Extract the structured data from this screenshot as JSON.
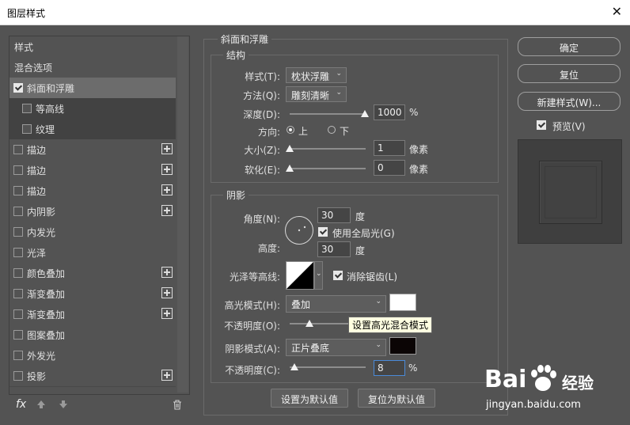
{
  "window": {
    "title": "图层样式",
    "close_glyph": "✕"
  },
  "left_list": {
    "items": [
      {
        "label": "样式",
        "checkbox": false,
        "checked": false,
        "plus": false,
        "state": "normal"
      },
      {
        "label": "混合选项",
        "checkbox": false,
        "checked": false,
        "plus": false,
        "state": "normal"
      },
      {
        "label": "斜面和浮雕",
        "checkbox": true,
        "checked": true,
        "plus": false,
        "state": "selected"
      },
      {
        "label": "等高线",
        "checkbox": true,
        "checked": false,
        "plus": false,
        "state": "sub"
      },
      {
        "label": "纹理",
        "checkbox": true,
        "checked": false,
        "plus": false,
        "state": "sub"
      },
      {
        "label": "描边",
        "checkbox": true,
        "checked": false,
        "plus": true,
        "state": "normal"
      },
      {
        "label": "描边",
        "checkbox": true,
        "checked": false,
        "plus": true,
        "state": "normal"
      },
      {
        "label": "描边",
        "checkbox": true,
        "checked": false,
        "plus": true,
        "state": "normal"
      },
      {
        "label": "内阴影",
        "checkbox": true,
        "checked": false,
        "plus": true,
        "state": "normal"
      },
      {
        "label": "内发光",
        "checkbox": true,
        "checked": false,
        "plus": false,
        "state": "normal"
      },
      {
        "label": "光泽",
        "checkbox": true,
        "checked": false,
        "plus": false,
        "state": "normal"
      },
      {
        "label": "颜色叠加",
        "checkbox": true,
        "checked": false,
        "plus": true,
        "state": "normal"
      },
      {
        "label": "渐变叠加",
        "checkbox": true,
        "checked": false,
        "plus": true,
        "state": "normal"
      },
      {
        "label": "渐变叠加",
        "checkbox": true,
        "checked": false,
        "plus": true,
        "state": "normal"
      },
      {
        "label": "图案叠加",
        "checkbox": true,
        "checked": false,
        "plus": false,
        "state": "normal"
      },
      {
        "label": "外发光",
        "checkbox": true,
        "checked": false,
        "plus": false,
        "state": "normal"
      },
      {
        "label": "投影",
        "checkbox": true,
        "checked": false,
        "plus": true,
        "state": "normal"
      }
    ],
    "fx_label": "fx",
    "icons": [
      "fx-icon",
      "up-arrow-icon",
      "down-arrow-icon",
      "trash-icon"
    ]
  },
  "bevel": {
    "section_title": "斜面和浮雕",
    "structure_title": "结构",
    "style_label": "样式(T):",
    "style_value": "枕状浮雕",
    "technique_label": "方法(Q):",
    "technique_value": "雕刻清晰",
    "depth_label": "深度(D):",
    "depth_value": "1000",
    "depth_unit": "%",
    "direction_label": "方向:",
    "direction_up": "上",
    "direction_down": "下",
    "size_label": "大小(Z):",
    "size_value": "1",
    "size_unit": "像素",
    "soften_label": "软化(E):",
    "soften_value": "0",
    "soften_unit": "像素"
  },
  "shading": {
    "title": "阴影",
    "angle_label": "角度(N):",
    "angle_value": "30",
    "angle_unit": "度",
    "global_light_label": "使用全局光(G)",
    "altitude_label": "高度:",
    "altitude_value": "30",
    "altitude_unit": "度",
    "gloss_contour_label": "光泽等高线:",
    "anti_alias_label": "消除锯齿(L)",
    "highlight_mode_label": "高光模式(H):",
    "highlight_mode_value": "叠加",
    "highlight_color": "#ffffff",
    "highlight_opacity_label": "不透明度(O):",
    "tooltip": "设置高光混合模式",
    "shadow_mode_label": "阴影模式(A):",
    "shadow_mode_value": "正片叠底",
    "shadow_color": "#0b0505",
    "shadow_opacity_label": "不透明度(C):",
    "shadow_opacity_value": "8",
    "shadow_opacity_unit": "%"
  },
  "bottom_buttons": {
    "set_default": "设置为默认值",
    "reset_default": "复位为默认值"
  },
  "right_buttons": {
    "ok": "确定",
    "reset": "复位",
    "new_style": "新建样式(W)...",
    "preview_label": "预览(V)"
  },
  "watermark": {
    "brand": "Bai",
    "brand_cn": "经验",
    "url": "jingyan.baidu.com"
  }
}
